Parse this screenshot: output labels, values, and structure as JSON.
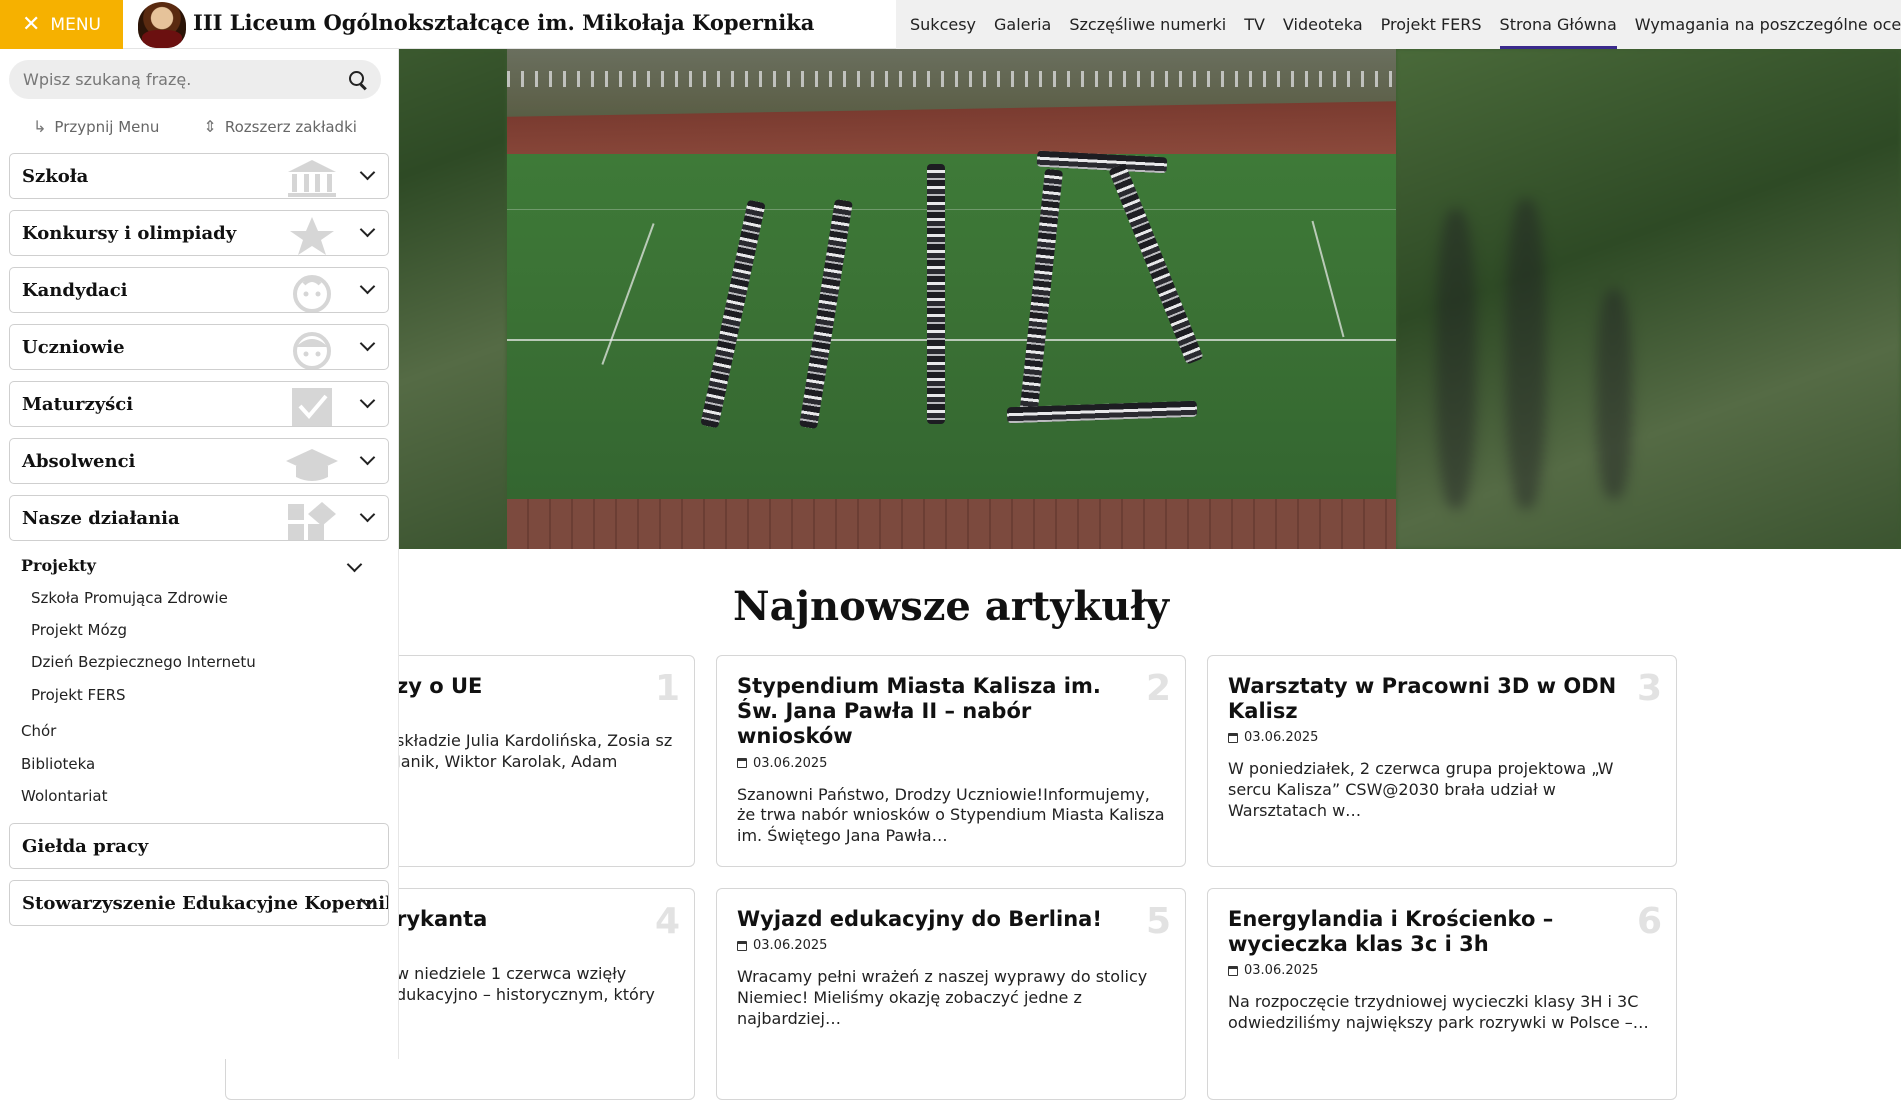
{
  "header": {
    "menu_label": "MENU",
    "school_name": "III Liceum Ogólnokształcące im. Mikołaja Kopernika",
    "nav": [
      "Sukcesy",
      "Galeria",
      "Szczęśliwe numerki",
      "TV",
      "Videoteka",
      "Projekt FERS",
      "Strona Główna",
      "Wymagania na poszczególne oceny"
    ],
    "active_nav": "Strona Główna"
  },
  "side": {
    "search_placeholder": "Wpisz szukaną frazę.",
    "pin_label": "Przypnij Menu",
    "expand_label": "Rozszerz zakładki",
    "categories": [
      "Szkoła",
      "Konkursy i olimpiady",
      "Kandydaci",
      "Uczniowie",
      "Maturzyści",
      "Absolwenci",
      "Nasze działania"
    ],
    "projects_heading": "Projekty",
    "projects": [
      "Szkoła Promująca Zdrowie",
      "Projekt Mózg",
      "Dzień Bezpiecznego Internetu",
      "Projekt FERS"
    ],
    "other_links": [
      "Chór",
      "Biblioteka",
      "Wolontariat"
    ],
    "bottom_categories": [
      "Giełda pracy",
      "Stowarzyszenie Edukacyjne Kopernik"
    ]
  },
  "main": {
    "section_title": "Najnowsze artykuły",
    "articles": [
      {
        "num": "1",
        "title": "zy o UE",
        "date": "",
        "excerpt": "składzie Julia Kardolińska, Zosia sz Janik, Wiktor Karolak, Adam"
      },
      {
        "num": "2",
        "title": "Stypendium Miasta Kalisza im. Św. Jana Pawła II – nabór wniosków",
        "date": "03.06.2025",
        "excerpt": "Szanowni Państwo, Drodzy Uczniowie!Informujemy, że trwa nabór wniosków o Stypendium Miasta Kalisza im. Świętego Jana Pawła…"
      },
      {
        "num": "3",
        "title": "Warsztaty w Pracowni 3D w ODN Kalisz",
        "date": "03.06.2025",
        "excerpt": "W poniedziałek, 2 czerwca grupa projektowa „W sercu Kalisza” CSW@2030 brała udział w Warsztatach w…"
      },
      {
        "num": "4",
        "title": "rykanta",
        "date": "",
        "excerpt": "w niedziele 1 czerwca wzięły dukacyjno – historycznym, który"
      },
      {
        "num": "5",
        "title": "Wyjazd edukacyjny do Berlina!",
        "date": "03.06.2025",
        "excerpt": "Wracamy pełni wrażeń z naszej wyprawy do stolicy Niemiec! Mieliśmy okazję zobaczyć jedne z najbardziej…"
      },
      {
        "num": "6",
        "title": "Energylandia i Krościenko – wycieczka klas 3c i 3h",
        "date": "03.06.2025",
        "excerpt": "Na rozpoczęcie trzydniowej wycieczki klasy 3H i 3C odwiedziliśmy największy park rozrywki w Polsce –…"
      }
    ]
  },
  "colors": {
    "accent": "#f6b100",
    "nav_active": "#3a2a8c"
  }
}
